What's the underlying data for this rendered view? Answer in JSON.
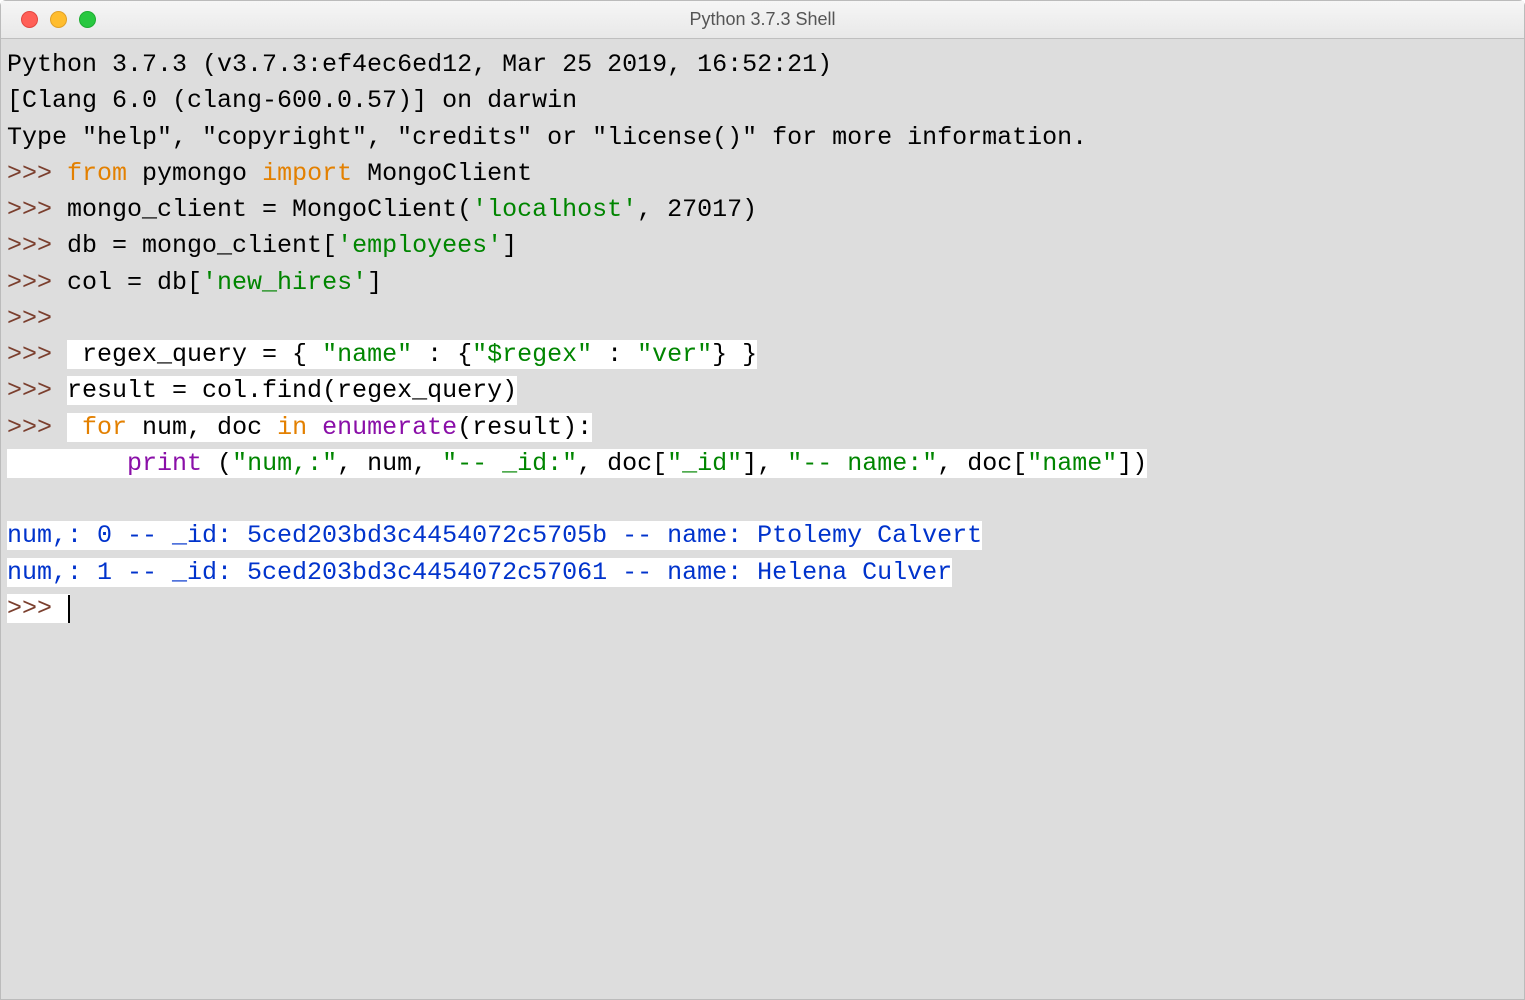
{
  "titlebar": {
    "title": "Python 3.7.3 Shell"
  },
  "banner": {
    "line1": "Python 3.7.3 (v3.7.3:ef4ec6ed12, Mar 25 2019, 16:52:21) ",
    "line2": "[Clang 6.0 (clang-600.0.57)] on darwin",
    "line3": "Type \"help\", \"copyright\", \"credits\" or \"license()\" for more information."
  },
  "prompt": ">>> ",
  "code": {
    "kw_from": "from",
    "kw_import": "import",
    "kw_for": "for",
    "kw_in": "in",
    "pymongo": " pymongo ",
    "mongoclient": " MongoClient",
    "assign_client": "mongo_client = MongoClient(",
    "str_localhost": "'localhost'",
    "port_close": ", 27017)",
    "assign_db": "db = mongo_client[",
    "str_employees": "'employees'",
    "close_bracket": "]",
    "assign_col": "col = db[",
    "str_newhires": "'new_hires'",
    "regex_lead": " regex_query = { ",
    "str_name_key": "\"name\"",
    "colon_brace": " : {",
    "str_regex_key": "\"$regex\"",
    "colon_space": " : ",
    "str_ver": "\"ver\"",
    "close_brace2": "} }",
    "result_line": "result = col.find(regex_query)",
    "for_lead_space": " ",
    "num_doc": " num, doc ",
    "enumerate": "enumerate",
    "enum_tail": "(result):",
    "print_indent": "        ",
    "print_name": "print",
    "print_open": " (",
    "str_numcomma": "\"num,:\"",
    "comma_num": ", num, ",
    "str_id": "\"-- _id:\"",
    "comma_doc_open": ", doc[",
    "str_id_key": "\"_id\"",
    "close_comma": "], ",
    "str_namecol": "\"-- name:\"",
    "str_name_key2": "\"name\"",
    "close_paren": "])"
  },
  "output": {
    "line1": "num,: 0 -- _id: 5ced203bd3c4454072c5705b -- name: Ptolemy Calvert",
    "line2": "num,: 1 -- _id: 5ced203bd3c4454072c57061 -- name: Helena Culver"
  }
}
